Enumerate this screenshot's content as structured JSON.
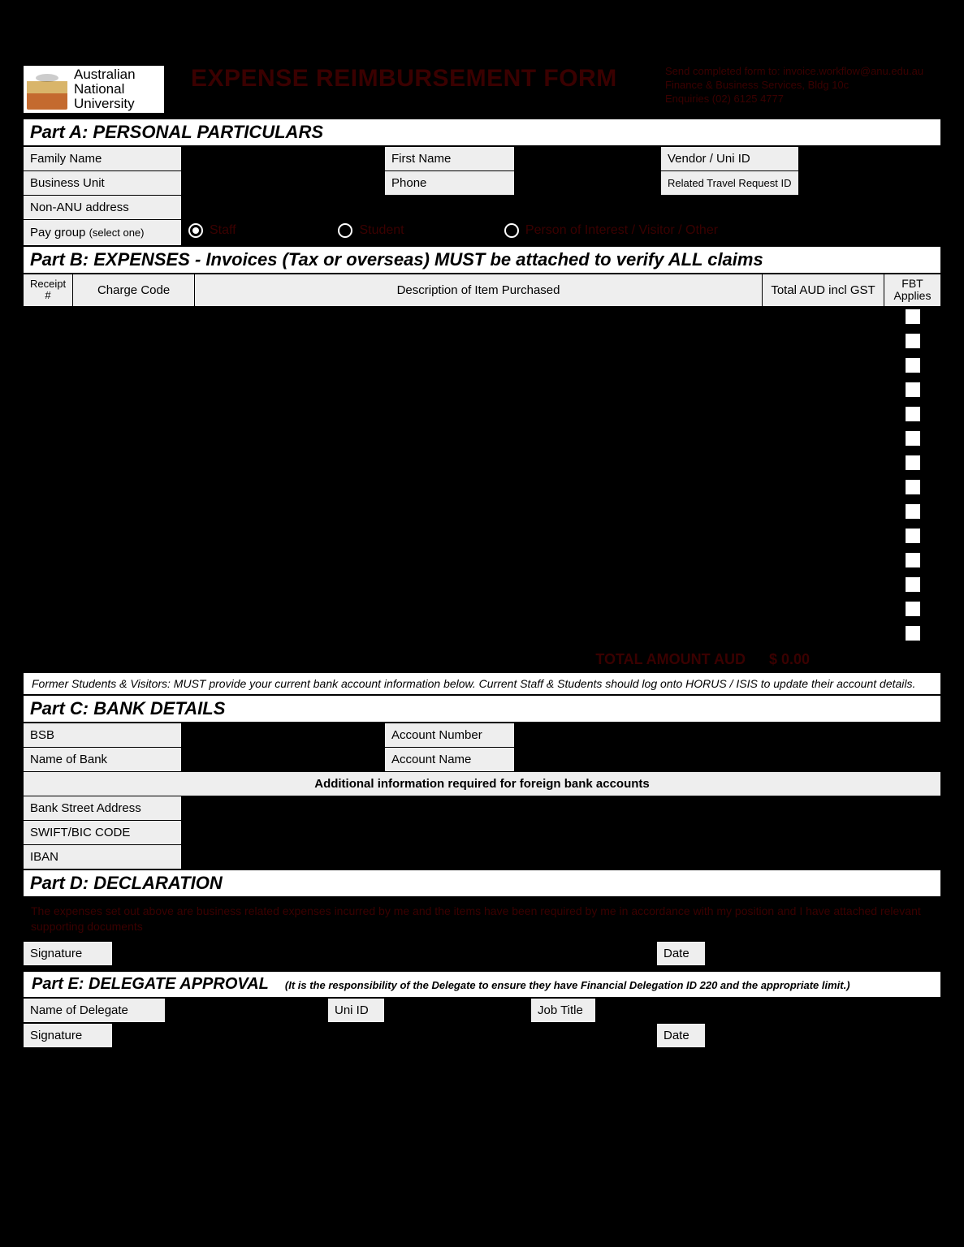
{
  "logo": {
    "line1": "Australian",
    "line2": "National",
    "line3": "University"
  },
  "form_title": "EXPENSE REIMBURSEMENT FORM",
  "header_info": {
    "line1": "Send completed form to: invoice.workflow@anu.edu.au",
    "line2": "Finance & Business Services, Bldg 10c",
    "line3": "Enquiries (02) 6125 4777"
  },
  "partA": {
    "title": "Part A: PERSONAL PARTICULARS",
    "labels": {
      "family_name": "Family Name",
      "first_name": "First Name",
      "vendor_id": "Vendor  /  Uni ID",
      "business_unit": "Business Unit",
      "phone": "Phone",
      "travel_id": "Related Travel Request ID",
      "non_anu": "Non-ANU address",
      "pay_group": "Pay group",
      "pay_group_hint": "(select one)"
    },
    "pay_options": {
      "staff": "Staff",
      "student": "Student",
      "other": "Person of Interest / Visitor / Other"
    }
  },
  "partB": {
    "title": "Part B: EXPENSES - Invoices (Tax or overseas) MUST be attached to verify ALL claims",
    "cols": {
      "receipt": "Receipt #",
      "charge": "Charge Code",
      "desc": "Description of Item Purchased",
      "total": "Total AUD incl GST",
      "fbt": "FBT Applies"
    },
    "row_count": 14,
    "total_label": "TOTAL AMOUNT AUD",
    "total_value": "$ 0.00",
    "note": "Former Students & Visitors: MUST provide your current bank account information below. Current Staff & Students should log onto HORUS / ISIS to update their account details."
  },
  "partC": {
    "title": "Part C: BANK DETAILS",
    "labels": {
      "bsb": "BSB",
      "acct_no": "Account Number",
      "bank_name": "Name of Bank",
      "acct_name": "Account Name",
      "foreign_hdr": "Additional information required for foreign bank accounts",
      "street": "Bank Street Address",
      "swift": "SWIFT/BIC CODE",
      "iban": "IBAN"
    }
  },
  "partD": {
    "title": "Part D: DECLARATION",
    "text": "The expenses set out above are business related expenses incurred by me and the items have been required by me in accordance with my position and I have attached relevant supporting documents",
    "signature": "Signature",
    "date": "Date"
  },
  "partE": {
    "title": "Part E: DELEGATE APPROVAL",
    "note": "(It is the responsibility of the Delegate to ensure they have Financial Delegation ID 220 and the appropriate limit.)",
    "labels": {
      "name": "Name of Delegate",
      "uni_id": "Uni ID",
      "job": "Job Title",
      "signature": "Signature",
      "date": "Date"
    }
  }
}
